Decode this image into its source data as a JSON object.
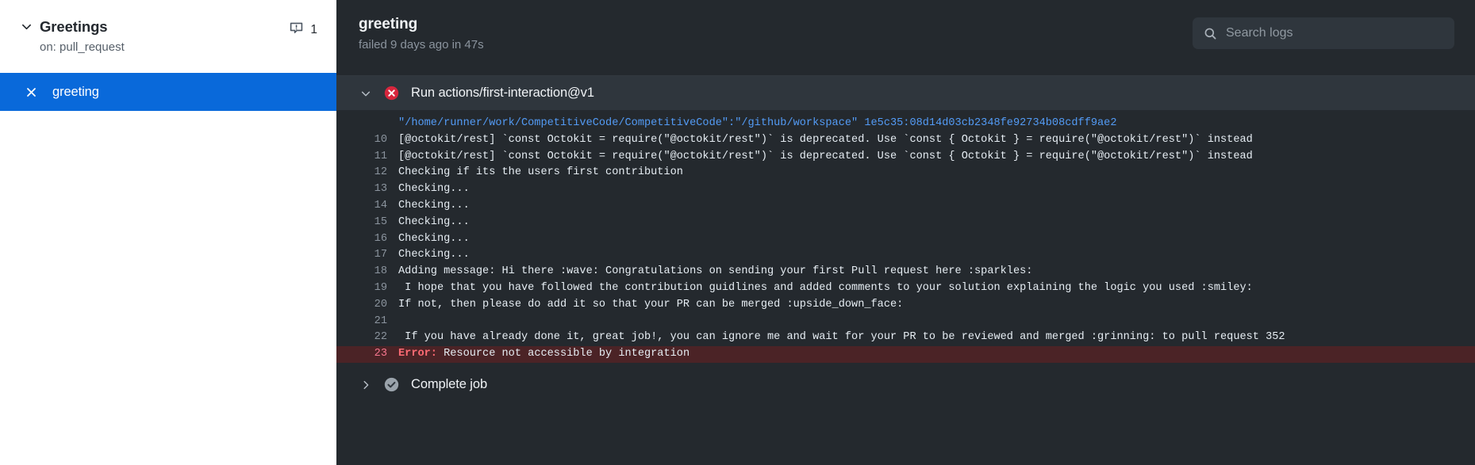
{
  "sidebar": {
    "workflow": {
      "name": "Greetings",
      "trigger": "on: pull_request",
      "caret_icon": "chevron-down-icon",
      "annotation_icon": "annotation-alert-icon",
      "annotation_count": "1"
    },
    "jobs": [
      {
        "label": "greeting",
        "status_icon": "x-icon",
        "selected": true
      }
    ]
  },
  "header": {
    "title": "greeting",
    "subtitle": "failed 9 days ago in 47s",
    "search": {
      "placeholder": "Search logs",
      "value": "",
      "icon": "search-icon"
    }
  },
  "steps": [
    {
      "label": "Run actions/first-interaction@v1",
      "caret_icon": "chevron-down-icon",
      "status_icon": "error-x-circle-icon",
      "expanded": true
    },
    {
      "label": "Complete job",
      "caret_icon": "chevron-right-icon",
      "status_icon": "success-check-circle-icon",
      "expanded": false
    }
  ],
  "log": {
    "lines": [
      {
        "num": "",
        "text": "\"/home/runner/work/CompetitiveCode/CompetitiveCode\":\"/github/workspace\" 1e5c35:08d14d03cb2348fe92734b08cdff9ae2",
        "style": "blue"
      },
      {
        "num": "10",
        "text": "[@octokit/rest] `const Octokit = require(\"@octokit/rest\")` is deprecated. Use `const { Octokit } = require(\"@octokit/rest\")` instead",
        "style": "normal"
      },
      {
        "num": "11",
        "text": "[@octokit/rest] `const Octokit = require(\"@octokit/rest\")` is deprecated. Use `const { Octokit } = require(\"@octokit/rest\")` instead",
        "style": "normal"
      },
      {
        "num": "12",
        "text": "Checking if its the users first contribution",
        "style": "normal"
      },
      {
        "num": "13",
        "text": "Checking...",
        "style": "normal"
      },
      {
        "num": "14",
        "text": "Checking...",
        "style": "normal"
      },
      {
        "num": "15",
        "text": "Checking...",
        "style": "normal"
      },
      {
        "num": "16",
        "text": "Checking...",
        "style": "normal"
      },
      {
        "num": "17",
        "text": "Checking...",
        "style": "normal"
      },
      {
        "num": "18",
        "text": "Adding message: Hi there :wave: Congratulations on sending your first Pull request here :sparkles:",
        "style": "normal"
      },
      {
        "num": "19",
        "text": " I hope that you have followed the contribution guidlines and added comments to your solution explaining the logic you used :smiley:",
        "style": "normal"
      },
      {
        "num": "20",
        "text": "If not, then please do add it so that your PR can be merged :upside_down_face:",
        "style": "normal"
      },
      {
        "num": "21",
        "text": "",
        "style": "normal"
      },
      {
        "num": "22",
        "text": " If you have already done it, great job!, you can ignore me and wait for your PR to be reviewed and merged :grinning: to pull request 352",
        "style": "normal"
      },
      {
        "num": "23",
        "text": "Resource not accessible by integration",
        "error_prefix": "Error:",
        "style": "error"
      }
    ]
  },
  "colors": {
    "accent_blue": "#0969da",
    "log_background": "#24292e",
    "step_header_background": "#2f363d",
    "error_red": "#f85149",
    "error_row_background": "#4b2326",
    "link_blue": "#539bf5",
    "success_grey": "#8b949e"
  }
}
